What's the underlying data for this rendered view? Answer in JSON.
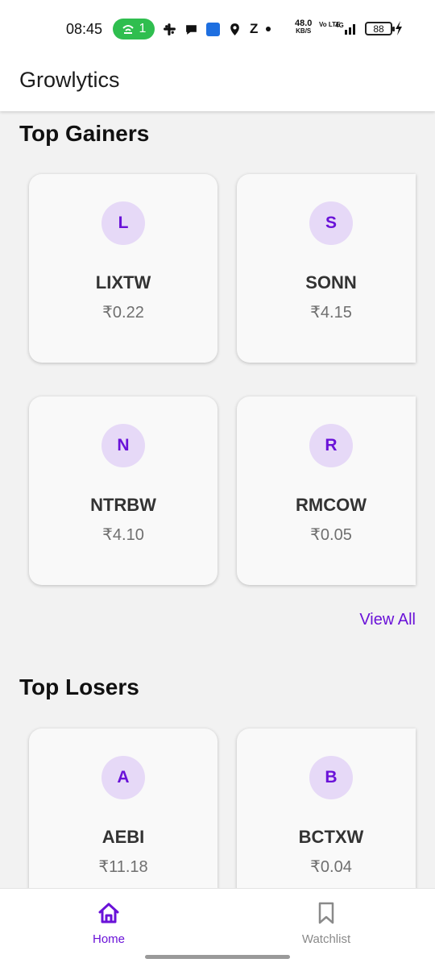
{
  "status_bar": {
    "time": "08:45",
    "hotspot_count": "1",
    "net_speed_value": "48.0",
    "net_speed_unit": "KB/S",
    "volte": "Vo LTE",
    "network": "4G",
    "battery": "88"
  },
  "app_bar": {
    "title": "Growlytics"
  },
  "top_gainers": {
    "title": "Top Gainers",
    "cards": [
      {
        "initial": "L",
        "ticker": "LIXTW",
        "price": "₹0.22"
      },
      {
        "initial": "S",
        "ticker": "SONN",
        "price": "₹4.15"
      },
      {
        "initial": "N",
        "ticker": "NTRBW",
        "price": "₹4.10"
      },
      {
        "initial": "R",
        "ticker": "RMCOW",
        "price": "₹0.05"
      }
    ],
    "view_all": "View All"
  },
  "top_losers": {
    "title": "Top Losers",
    "cards": [
      {
        "initial": "A",
        "ticker": "AEBI",
        "price": "₹11.18"
      },
      {
        "initial": "B",
        "ticker": "BCTXW",
        "price": "₹0.04"
      }
    ]
  },
  "bottom_nav": {
    "items": [
      {
        "label": "Home",
        "icon": "home-icon",
        "active": true
      },
      {
        "label": "Watchlist",
        "icon": "bookmark-icon",
        "active": false
      }
    ]
  },
  "colors": {
    "accent": "#6a12d8",
    "avatar_bg": "#e6d9f7",
    "hotspot_pill": "#2fbe4f",
    "background": "#f2f2f2"
  }
}
